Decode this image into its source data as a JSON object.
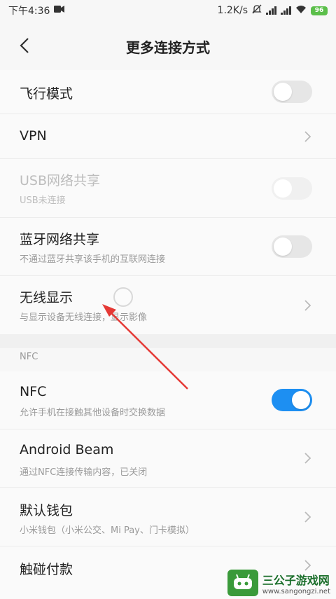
{
  "status_bar": {
    "time": "下午4:36",
    "net_speed": "1.2K/s",
    "battery": "96"
  },
  "header": {
    "title": "更多连接方式"
  },
  "rows_top": [
    {
      "title": "飞行模式",
      "subtitle": "",
      "control": "toggle",
      "state": "off"
    },
    {
      "title": "VPN",
      "subtitle": "",
      "control": "chevron"
    },
    {
      "title": "USB网络共享",
      "subtitle": "USB未连接",
      "control": "toggle",
      "state": "disabled"
    },
    {
      "title": "蓝牙网络共享",
      "subtitle": "不通过蓝牙共享该手机的互联网连接",
      "control": "toggle",
      "state": "off"
    },
    {
      "title": "无线显示",
      "subtitle": "与显示设备无线连接，显示影像",
      "control": "chevron"
    }
  ],
  "nfc_section": {
    "header": "NFC",
    "rows": [
      {
        "title": "NFC",
        "subtitle": "允许手机在接触其他设备时交换数据",
        "control": "toggle",
        "state": "on"
      },
      {
        "title": "Android Beam",
        "subtitle": "通过NFC连接传输内容，已关闭",
        "control": "chevron"
      },
      {
        "title": "默认钱包",
        "subtitle": "小米钱包（小米公交、Mi Pay、门卡模拟）",
        "control": "chevron"
      },
      {
        "title": "触碰付款",
        "subtitle": "",
        "control": "chevron"
      }
    ]
  },
  "colors": {
    "accent": "#1d8ff2",
    "annotation": "#e53935"
  },
  "watermark": {
    "title": "三公子游戏网",
    "url": "www.sangongzi.net"
  }
}
